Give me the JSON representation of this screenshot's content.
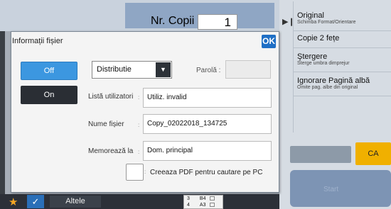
{
  "copies": {
    "label": "Nr. Copii",
    "value": "1"
  },
  "right_panel": {
    "items": [
      {
        "title": "Original",
        "subtitle": "Schimba Format/Orientare"
      },
      {
        "title": "Copie 2 fețe",
        "subtitle": ""
      },
      {
        "title": "Ştergere",
        "subtitle": "Sterge umbra dimprejur"
      },
      {
        "title": "Ignorare Pagină albă",
        "subtitle": "Omite pag. albe din original"
      }
    ],
    "ca_label": "CA",
    "start_label": "Start"
  },
  "bottom_bar": {
    "altele_label": "Altele",
    "paper_rows": [
      {
        "tray": "3",
        "size": "B4"
      },
      {
        "tray": "4",
        "size": "A3"
      }
    ]
  },
  "dialog": {
    "title": "Informații fișier",
    "ok_label": "OK",
    "off_label": "Off",
    "on_label": "On",
    "distribution_select": "Distributie",
    "parola_label": "Parolă",
    "user_list_label": "Listă utilizatori",
    "user_list_value": "Utiliz. invalid",
    "file_name_label": "Nume fișier",
    "file_name_value": "Copy_02022018_134725",
    "save_in_label": "Memorează la",
    "save_in_value": "Dom. principal",
    "pdf_search_label": "Creeaza PDF pentru cautare pe PC"
  },
  "colors": {
    "accent_blue": "#3c97e0",
    "ok_blue": "#1f6fc5",
    "ca_yellow": "#f0b000",
    "star": "#f5a623"
  }
}
